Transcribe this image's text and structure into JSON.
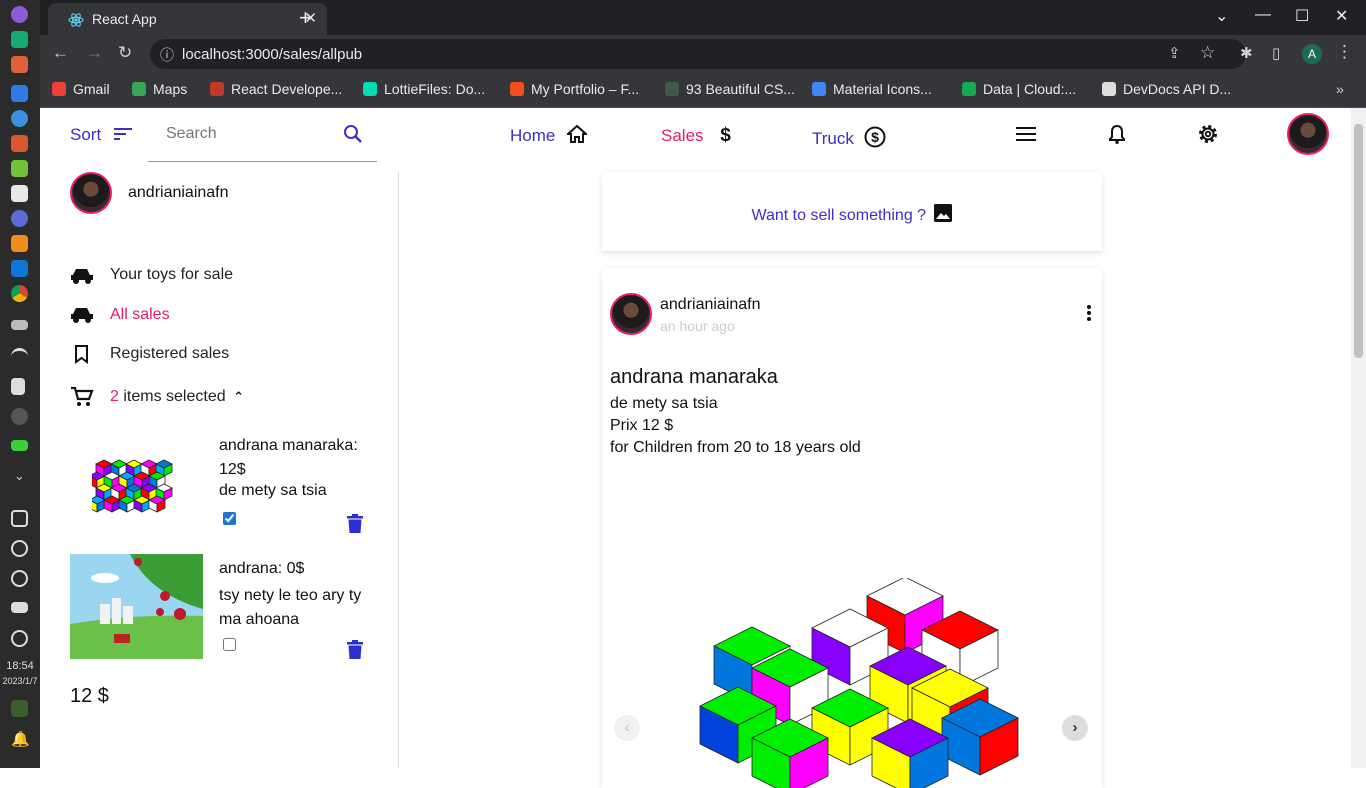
{
  "os": {
    "time": "18:54",
    "date": "2023/1/7"
  },
  "browser": {
    "tab_title": "React App",
    "url": "localhost:3000/sales/allpub",
    "profile_letter": "A",
    "bookmarks": [
      {
        "label": "Gmail",
        "color": "#ea4335"
      },
      {
        "label": "Maps",
        "color": "#34a853"
      },
      {
        "label": "React Develope...",
        "color": "#c0392b"
      },
      {
        "label": "LottieFiles: Do...",
        "color": "#00ddb3"
      },
      {
        "label": "My Portfolio – F...",
        "color": "#f24e1e"
      },
      {
        "label": "93 Beautiful CS...",
        "color": "#3d5a4a"
      },
      {
        "label": "Material Icons...",
        "color": "#4285f4"
      },
      {
        "label": "Data | Cloud:...",
        "color": "#13aa52"
      },
      {
        "label": "DevDocs API D...",
        "color": "#dddddd"
      }
    ]
  },
  "header": {
    "sort_label": "Sort",
    "search_placeholder": "Search",
    "nav": {
      "home": "Home",
      "sales": "Sales",
      "truck": "Truck"
    }
  },
  "sidebar": {
    "username": "andrianiainafn",
    "items": {
      "toys": "Your toys for sale",
      "all": "All sales",
      "registered": "Registered sales"
    },
    "cart": {
      "count": "2",
      "label": "items selected"
    },
    "cart_items": [
      {
        "name_price": "andrana manaraka: 12$",
        "desc": "de mety sa tsia",
        "checked": true
      },
      {
        "name_price": "andrana: 0$",
        "desc": "tsy nety le teo ary ty ma ahoana",
        "checked": false
      }
    ],
    "total": "12 $"
  },
  "main": {
    "sell_prompt": "Want to sell something ?",
    "post": {
      "author": "andrianiainafn",
      "time": "an hour ago",
      "title": "andrana manaraka",
      "desc": "de mety sa tsia",
      "price": "Prix 12 $",
      "age": "for Children from 20 to 18 years old"
    }
  }
}
